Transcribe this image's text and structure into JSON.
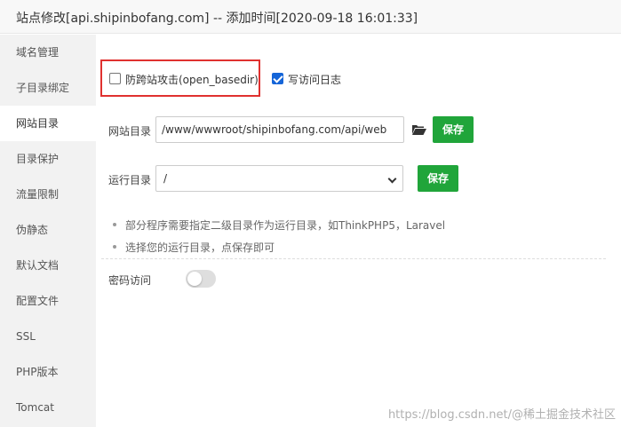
{
  "window": {
    "title": "站点修改[api.shipinbofang.com] -- 添加时间[2020-09-18 16:01:33]"
  },
  "sidebar": {
    "items": [
      {
        "label": "域名管理"
      },
      {
        "label": "子目录绑定"
      },
      {
        "label": "网站目录",
        "active": true
      },
      {
        "label": "目录保护"
      },
      {
        "label": "流量限制"
      },
      {
        "label": "伪静态"
      },
      {
        "label": "默认文档"
      },
      {
        "label": "配置文件"
      },
      {
        "label": "SSL"
      },
      {
        "label": "PHP版本"
      },
      {
        "label": "Tomcat"
      }
    ]
  },
  "options": {
    "open_basedir": {
      "label": "防跨站攻击(open_basedir)",
      "checked": false
    },
    "access_log": {
      "label": "写访问日志",
      "checked": true
    }
  },
  "site_dir": {
    "label": "网站目录",
    "value": "/www/wwwroot/shipinbofang.com/api/web",
    "browse_icon": "folder-open-icon",
    "save_label": "保存"
  },
  "run_dir": {
    "label": "运行目录",
    "selected": "/",
    "save_label": "保存"
  },
  "tips": [
    "部分程序需要指定二级目录作为运行目录，如ThinkPHP5，Laravel",
    "选择您的运行目录，点保存即可"
  ],
  "password_access": {
    "label": "密码访问",
    "enabled": false
  },
  "watermark": "https://blog.csdn.net/@稀土掘金技术社区",
  "colors": {
    "accent_green": "#20a53a",
    "highlight_red": "#e0312f",
    "checkbox_blue": "#1565d8"
  }
}
